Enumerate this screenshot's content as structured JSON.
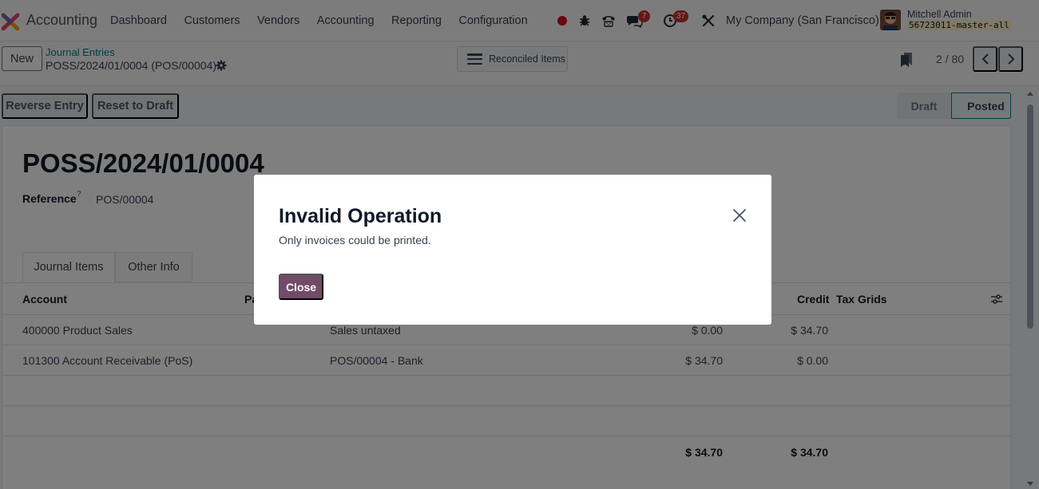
{
  "navbar": {
    "app_name": "Accounting",
    "menu": [
      "Dashboard",
      "Customers",
      "Vendors",
      "Accounting",
      "Reporting",
      "Configuration"
    ],
    "chat_badge": "7",
    "activity_badge": "37",
    "company": "My Company (San Francisco)",
    "user_name": "Mitchell Admin",
    "user_db": "56723011-master-all"
  },
  "control": {
    "new_label": "New",
    "breadcrumb_parent": "Journal Entries",
    "breadcrumb_current": "POSS/2024/01/0004 (POS/00004)",
    "reconciled_label": "Reconciled Items",
    "pager": "2 / 80"
  },
  "actions": {
    "reverse_label": "Reverse Entry",
    "reset_label": "Reset to Draft"
  },
  "status": {
    "draft": "Draft",
    "posted": "Posted"
  },
  "form": {
    "title": "POSS/2024/01/0004",
    "reference_label": "Reference",
    "reference_help": "?",
    "reference_value": "POS/00004",
    "tabs": [
      "Journal Items",
      "Other Info"
    ]
  },
  "table": {
    "headers": {
      "account": "Account",
      "partner": "Pa",
      "credit": "Credit",
      "tax_grids": "Tax Grids"
    },
    "rows": [
      {
        "account": "400000 Product Sales",
        "label": "Sales untaxed",
        "debit": "$ 0.00",
        "credit": "$ 34.70"
      },
      {
        "account": "101300 Account Receivable (PoS)",
        "label": "POS/00004 - Bank",
        "debit": "$ 34.70",
        "credit": "$ 0.00"
      }
    ],
    "total_debit": "$ 34.70",
    "total_credit": "$ 34.70"
  },
  "modal": {
    "title": "Invalid Operation",
    "body": "Only invoices could be printed.",
    "close_label": "Close"
  },
  "colors": {
    "brand": "#714b67",
    "accent": "#017e84",
    "badge": "#c9302c"
  }
}
